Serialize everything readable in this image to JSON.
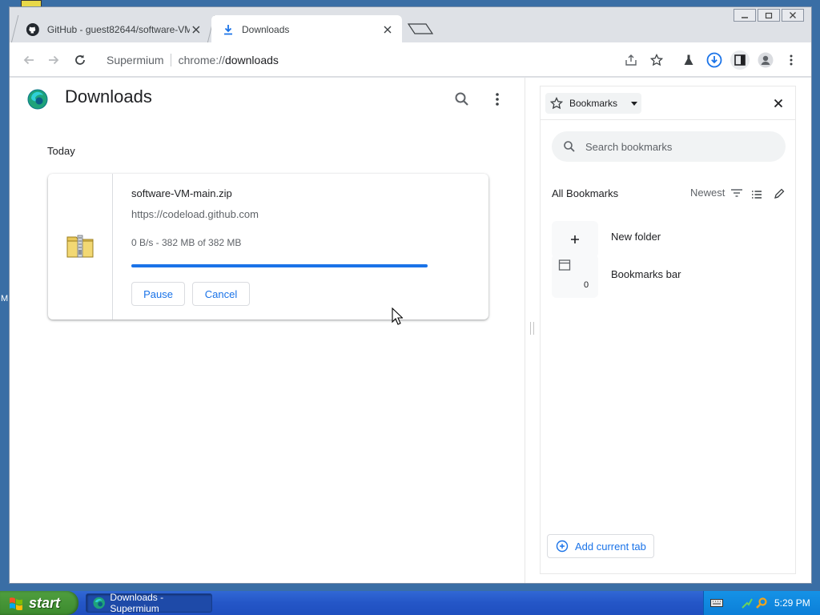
{
  "desktop": {
    "edge_text": "M"
  },
  "tabs": [
    {
      "label": "GitHub - guest82644/software-VM",
      "icon": "github-icon",
      "active": false
    },
    {
      "label": "Downloads",
      "icon": "download-icon",
      "active": true
    }
  ],
  "omnibox": {
    "brand": "Supermium",
    "url_prefix": "chrome://",
    "url_host": "downloads"
  },
  "downloads": {
    "title": "Downloads",
    "section": "Today",
    "items": [
      {
        "file_name": "software-VM-main.zip",
        "url": "https://codeload.github.com",
        "status": "0 B/s - 382 MB of 382 MB",
        "progress_percent": 100,
        "pause_label": "Pause",
        "cancel_label": "Cancel"
      }
    ]
  },
  "bookmarks_panel": {
    "selector_label": "Bookmarks",
    "search_placeholder": "Search bookmarks",
    "all_label": "All Bookmarks",
    "sort_label": "Newest",
    "rows": [
      {
        "label": "New folder",
        "icon": "plus-icon"
      },
      {
        "label": "Bookmarks bar",
        "icon": "folder-icon",
        "count": "0"
      }
    ],
    "add_current_tab": "Add current tab"
  },
  "taskbar": {
    "start_label": "start",
    "task_label": "Downloads - Supermium",
    "time": "5:29 PM"
  },
  "colors": {
    "accent": "#1a73e8",
    "taskbar": "#2456c7",
    "start_green": "#3c8a2e"
  }
}
